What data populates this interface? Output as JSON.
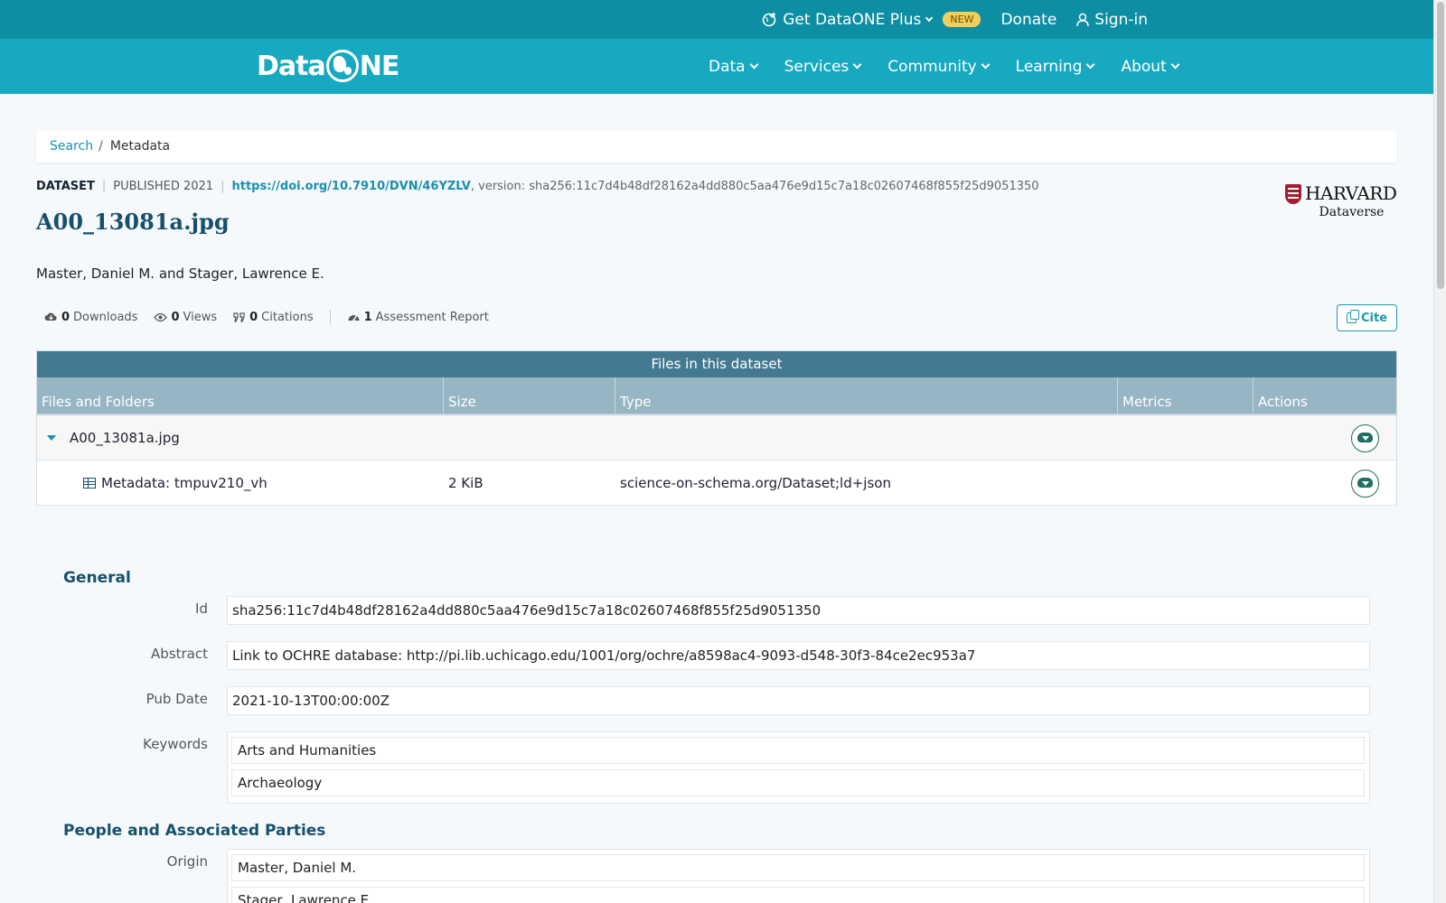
{
  "topbar": {
    "plus_label": "Get DataONE Plus",
    "new_badge": "NEW",
    "donate_label": "Donate",
    "signin_label": "Sign-in"
  },
  "navbar": {
    "logo_text_left": "Data",
    "logo_text_right": "NE",
    "menu": [
      "Data",
      "Services",
      "Community",
      "Learning",
      "About"
    ]
  },
  "breadcrumb": {
    "link": "Search",
    "separator": "/",
    "current": "Metadata"
  },
  "dataset": {
    "type_tag": "DATASET",
    "published": "PUBLISHED 2021",
    "doi": "https://doi.org/10.7910/DVN/46YZLV",
    "version_text": ", version: sha256:11c7d4b48df28162a4dd880c5aa476e9d15c7a18c02607468f855f25d9051350",
    "title": "A00_13081a.jpg",
    "authors": "Master, Daniel M. and Stager, Lawrence E.",
    "repository": {
      "name": "HARVARD",
      "sub": "Dataverse"
    }
  },
  "stats": {
    "downloads_count": "0",
    "downloads_label": "Downloads",
    "views_count": "0",
    "views_label": "Views",
    "citations_count": "0",
    "citations_label": "Citations",
    "assessment_count": "1",
    "assessment_label": "Assessment Report"
  },
  "cite_label": "Cite",
  "files": {
    "heading": "Files in this dataset",
    "columns": [
      "Files and Folders",
      "Size",
      "Type",
      "Metrics",
      "Actions"
    ],
    "package_name": "A00_13081a.jpg",
    "rows": [
      {
        "name": "Metadata: tmpuv210_vh",
        "size": "2 KiB",
        "type": "science-on-schema.org/Dataset;ld+json"
      }
    ]
  },
  "general": {
    "heading": "General",
    "id_label": "Id",
    "id_value": "sha256:11c7d4b48df28162a4dd880c5aa476e9d15c7a18c02607468f855f25d9051350",
    "abstract_label": "Abstract",
    "abstract_value": "Link to OCHRE database: http://pi.lib.uchicago.edu/1001/org/ochre/a8598ac4-9093-d548-30f3-84ce2ec953a7",
    "pubdate_label": "Pub Date",
    "pubdate_value": "2021-10-13T00:00:00Z",
    "keywords_label": "Keywords",
    "keywords": [
      "Arts and Humanities",
      "Archaeology"
    ]
  },
  "people": {
    "heading": "People and Associated Parties",
    "origin_label": "Origin",
    "origins": [
      "Master, Daniel M.",
      "Stager, Lawrence E."
    ]
  },
  "colors": {
    "topbar": "#0d8ea3",
    "navbar": "#17a9c0",
    "accent": "#1a8fb0",
    "table_header": "#437a91",
    "table_columns": "#97b6c4"
  }
}
